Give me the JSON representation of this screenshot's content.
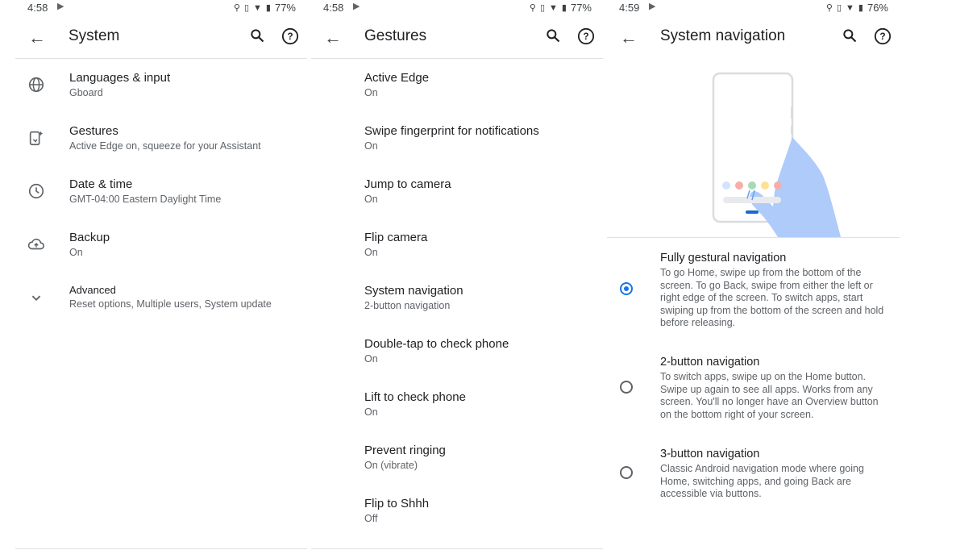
{
  "panels": {
    "system": {
      "status": {
        "time": "4:58",
        "battery": "77%"
      },
      "title": "System",
      "items": [
        {
          "title": "Languages & input",
          "subtitle": "Gboard",
          "icon": "globe-icon"
        },
        {
          "title": "Gestures",
          "subtitle": "Active Edge on, squeeze for your Assistant",
          "icon": "gestures-icon"
        },
        {
          "title": "Date & time",
          "subtitle": "GMT-04:00 Eastern Daylight Time",
          "icon": "clock-icon"
        },
        {
          "title": "Backup",
          "subtitle": "On",
          "icon": "cloud-upload-icon"
        },
        {
          "title": "Advanced",
          "subtitle": "Reset options, Multiple users, System update",
          "icon": "chevron-down-icon"
        }
      ]
    },
    "gestures": {
      "status": {
        "time": "4:58",
        "battery": "77%"
      },
      "title": "Gestures",
      "items": [
        {
          "title": "Active Edge",
          "subtitle": "On"
        },
        {
          "title": "Swipe fingerprint for notifications",
          "subtitle": "On"
        },
        {
          "title": "Jump to camera",
          "subtitle": "On"
        },
        {
          "title": "Flip camera",
          "subtitle": "On"
        },
        {
          "title": "System navigation",
          "subtitle": "2-button navigation"
        },
        {
          "title": "Double-tap to check phone",
          "subtitle": "On"
        },
        {
          "title": "Lift to check phone",
          "subtitle": "On"
        },
        {
          "title": "Prevent ringing",
          "subtitle": "On (vibrate)"
        },
        {
          "title": "Flip to Shhh",
          "subtitle": "Off"
        }
      ]
    },
    "navigation": {
      "status": {
        "time": "4:59",
        "battery": "76%"
      },
      "title": "System navigation",
      "options": [
        {
          "title": "Fully gestural navigation",
          "desc": "To go Home, swipe up from the bottom of the screen. To go Back, swipe from either the left or right edge of the screen. To switch apps, start swiping up from the bottom of the screen and hold before releasing.",
          "selected": true
        },
        {
          "title": "2-button navigation",
          "desc": "To switch apps, swipe up on the Home button. Swipe up again to see all apps. Works from any screen. You'll no longer have an Overview button on the bottom right of your screen.",
          "selected": false
        },
        {
          "title": "3-button navigation",
          "desc": "Classic Android navigation mode where going Home, switching apps, and going Back are accessible via buttons.",
          "selected": false
        }
      ]
    }
  },
  "colors": {
    "accent": "#1a73e8",
    "illustration_blue": "#aecbfa"
  }
}
